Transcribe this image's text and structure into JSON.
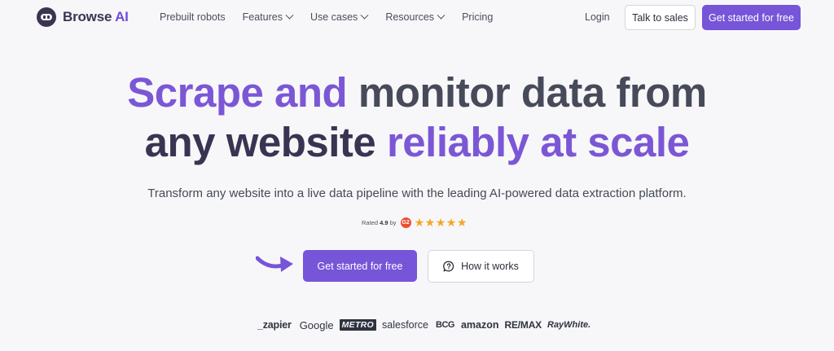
{
  "nav": {
    "brand_main": "Browse ",
    "brand_accent": "AI",
    "menu": [
      {
        "label": "Prebuilt robots",
        "dropdown": false
      },
      {
        "label": "Features",
        "dropdown": true
      },
      {
        "label": "Use cases",
        "dropdown": true
      },
      {
        "label": "Resources",
        "dropdown": true
      },
      {
        "label": "Pricing",
        "dropdown": false
      }
    ],
    "login": "Login",
    "talk_to_sales": "Talk to sales",
    "cta": "Get started for free"
  },
  "hero": {
    "line1_part1": "Scrape and ",
    "line1_part2": "monitor data from",
    "line2_part1": "any website ",
    "line2_part2": "reliably at scale",
    "subtitle": "Transform any website into a live data pipeline with the leading AI-powered data extraction platform.",
    "rating_prefix": "Rated ",
    "rating_value": "4.9",
    "rating_suffix": " by",
    "rating_badge": "G2",
    "stars": 5,
    "cta_primary": "Get started for free",
    "cta_secondary": "How it works"
  },
  "logos": [
    "_zapier",
    "Google",
    "METRO",
    "salesforce",
    "BCG",
    "amazon",
    "RE/MAX",
    "RayWhite."
  ],
  "colors": {
    "accent": "#7655d8",
    "headline_purple": "#7b57d6",
    "headline_slate": "#464a59",
    "headline_dark": "#3a3352",
    "star": "#f5a524",
    "g2_red": "#ef4b2f"
  }
}
